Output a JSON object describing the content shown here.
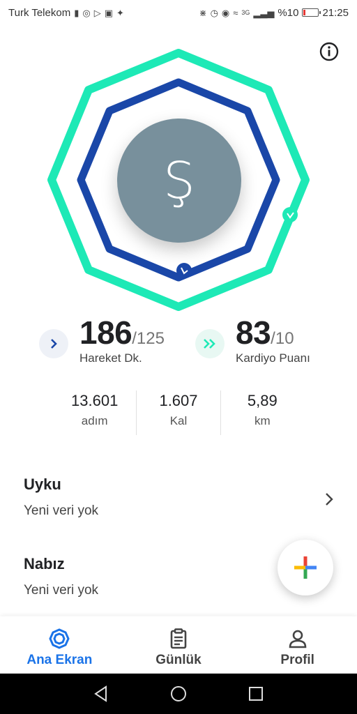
{
  "status_bar": {
    "carrier": "Turk Telekom",
    "battery": "%10",
    "battery_level": 0.1,
    "network": "3G",
    "time": "21:25"
  },
  "rings": {
    "move_ring_color": "#1de9b6",
    "cardio_ring_color": "#1a47a8",
    "avatar_letter": "Ş",
    "avatar_color": "#78909c"
  },
  "goals": {
    "move": {
      "value": "186",
      "target": "/125",
      "label": "Hareket Dk."
    },
    "cardio": {
      "value": "83",
      "target": "/10",
      "label": "Kardiyo Puanı"
    }
  },
  "stats": [
    {
      "value": "13.601",
      "label": "adım"
    },
    {
      "value": "1.607",
      "label": "Kal"
    },
    {
      "value": "5,89",
      "label": "km"
    }
  ],
  "cards": {
    "sleep": {
      "title": "Uyku",
      "subtitle": "Yeni veri yok"
    },
    "heart": {
      "title": "Nabız",
      "subtitle": "Yeni veri yok"
    }
  },
  "bottom_nav": [
    {
      "label": "Ana Ekran",
      "icon": "home-ring-icon",
      "active": true
    },
    {
      "label": "Günlük",
      "icon": "journal-icon",
      "active": false
    },
    {
      "label": "Profil",
      "icon": "profile-icon",
      "active": false
    }
  ],
  "colors": {
    "accent": "#1a73e8",
    "teal": "#1de9b6",
    "navy": "#1a47a8"
  }
}
